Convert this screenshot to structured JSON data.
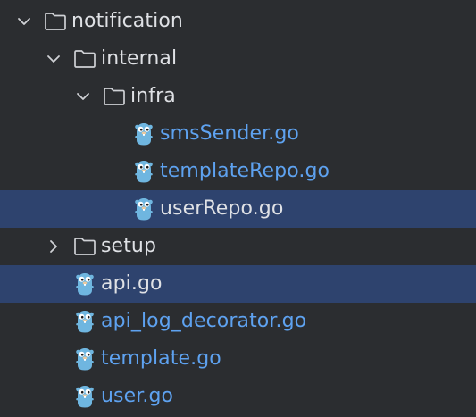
{
  "tree": {
    "notification": {
      "label": "notification",
      "expanded": true,
      "icon": "folder-icon"
    },
    "internal": {
      "label": "internal",
      "expanded": true,
      "icon": "folder-icon"
    },
    "infra": {
      "label": "infra",
      "expanded": true,
      "icon": "folder-icon"
    },
    "sms_sender": {
      "label": "smsSender.go",
      "icon": "go-gopher-icon"
    },
    "template_repo": {
      "label": "templateRepo.go",
      "icon": "go-gopher-icon"
    },
    "user_repo": {
      "label": "userRepo.go",
      "icon": "go-gopher-icon",
      "selected": true
    },
    "setup": {
      "label": "setup",
      "expanded": false,
      "icon": "folder-icon"
    },
    "api": {
      "label": "api.go",
      "icon": "go-gopher-icon",
      "selected": true
    },
    "api_log_decorator": {
      "label": "api_log_decorator.go",
      "icon": "go-gopher-icon"
    },
    "template": {
      "label": "template.go",
      "icon": "go-gopher-icon"
    },
    "user": {
      "label": "user.go",
      "icon": "go-gopher-icon"
    }
  },
  "colors": {
    "background": "#2b2d30",
    "selection": "#2e436e",
    "directory_text": "#dfe1e5",
    "go_file_text": "#5ea2f0",
    "gopher": "#6fb6e0"
  }
}
